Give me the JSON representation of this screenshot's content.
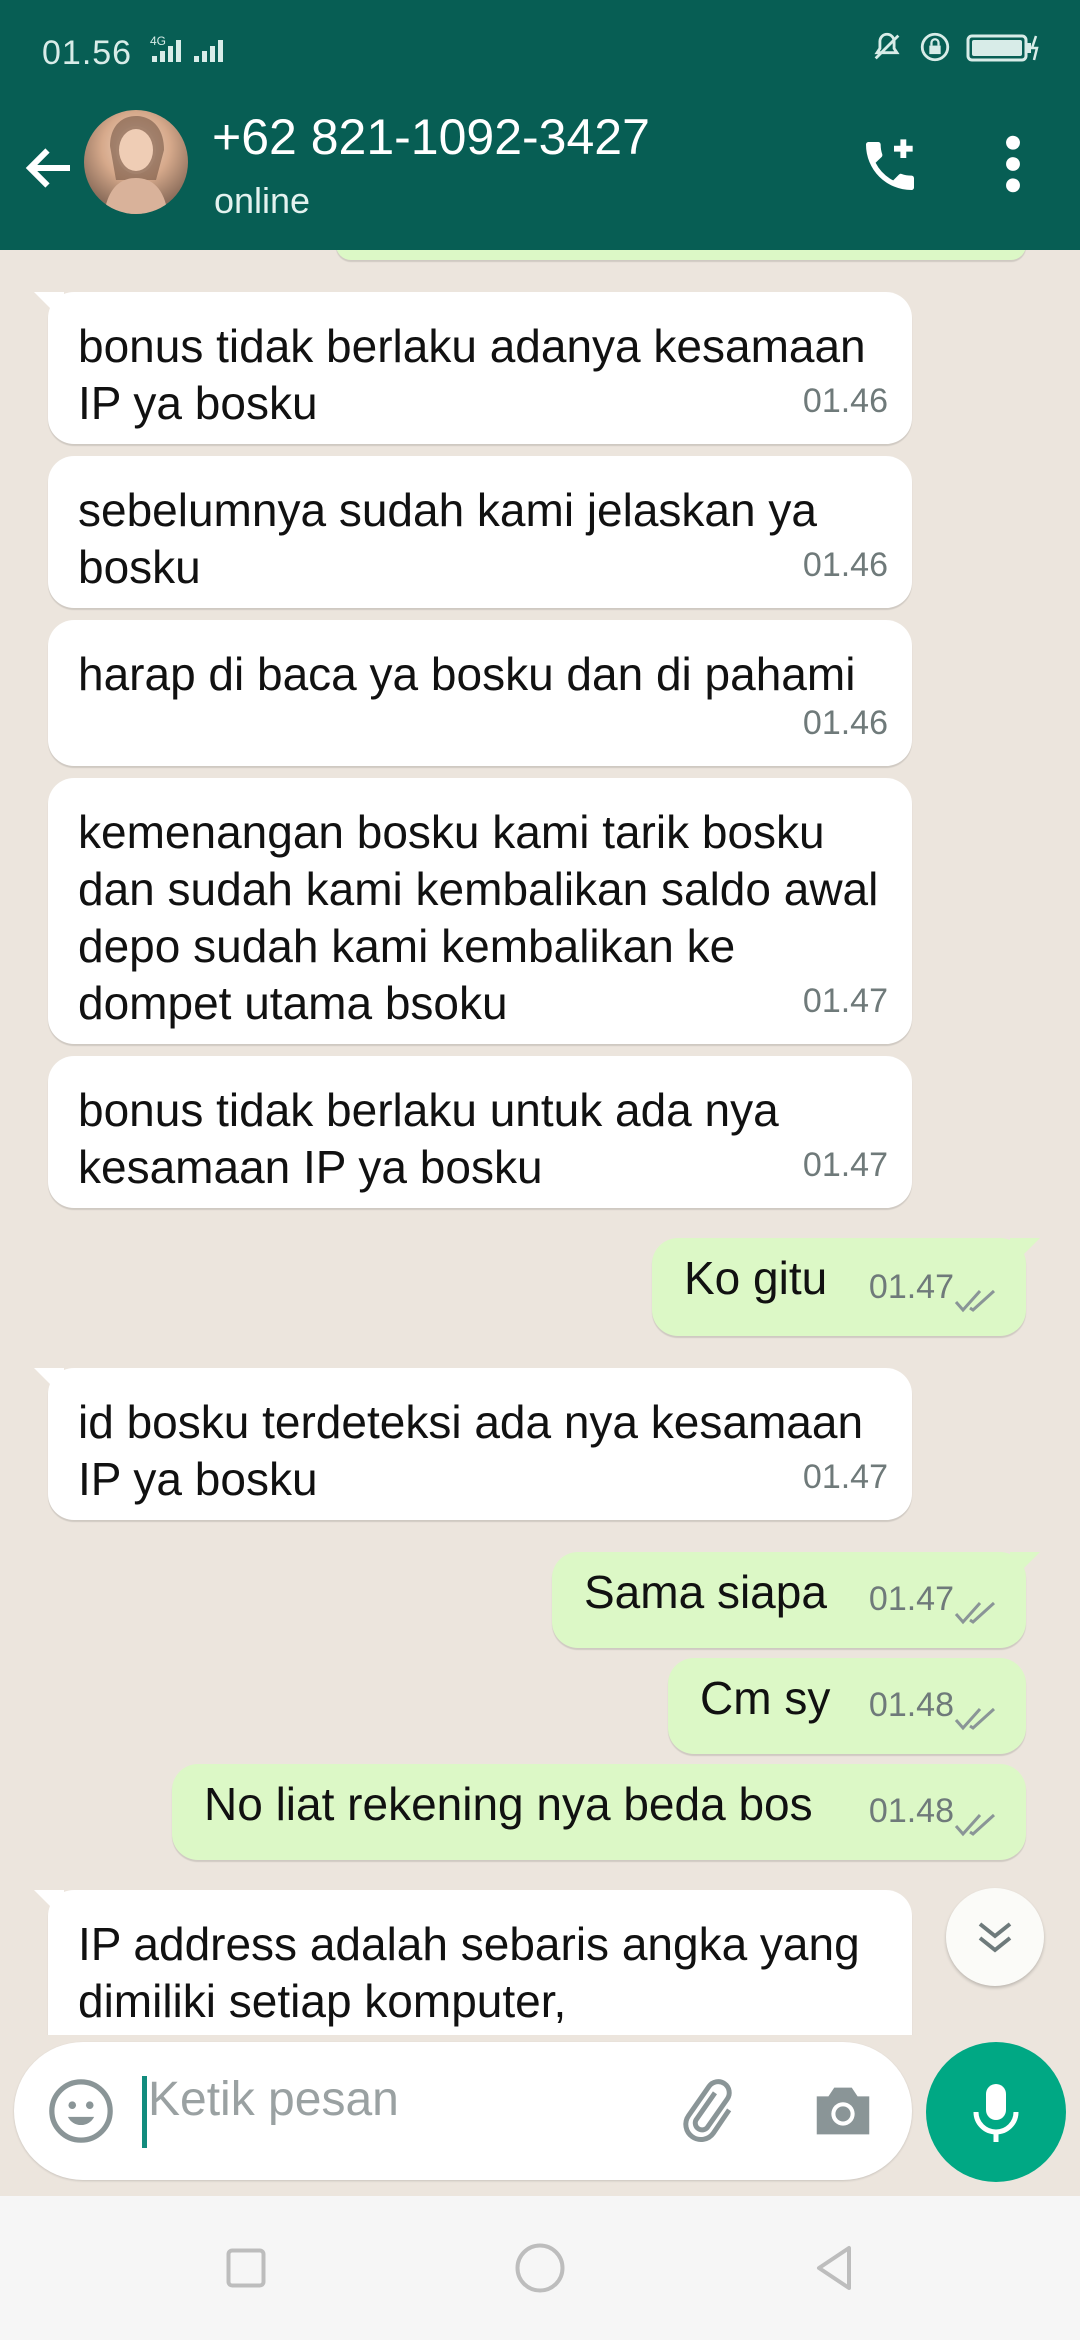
{
  "status_bar": {
    "time": "01.56",
    "network": "4G"
  },
  "header": {
    "contact_name": "+62 821-1092-3427",
    "presence": "online"
  },
  "messages": [
    {
      "dir": "in",
      "text": "bonus tidak berlaku adanya kesamaan IP ya bosku",
      "time": "01.46"
    },
    {
      "dir": "in",
      "text": "sebelumnya sudah kami jelaskan ya bosku",
      "time": "01.46"
    },
    {
      "dir": "in",
      "text": "harap di baca ya bosku dan di pahami",
      "time": "01.46"
    },
    {
      "dir": "in",
      "text": "kemenangan bosku kami tarik bosku dan sudah kami kembalikan saldo awal depo sudah kami kembalikan ke dompet utama bsoku",
      "time": "01.47"
    },
    {
      "dir": "in",
      "text": "bonus tidak berlaku untuk ada nya kesamaan IP ya bosku",
      "time": "01.47"
    },
    {
      "dir": "out",
      "text": "Ko gitu",
      "time": "01.47",
      "status": "read"
    },
    {
      "dir": "in",
      "text": "id bosku terdeteksi ada nya kesamaan IP ya bosku",
      "time": "01.47"
    },
    {
      "dir": "out",
      "text": "Sama siapa",
      "time": "01.47",
      "status": "read"
    },
    {
      "dir": "out",
      "text": "Cm sy",
      "time": "01.48",
      "status": "read"
    },
    {
      "dir": "out",
      "text": "No liat rekening nya beda bos",
      "time": "01.48",
      "status": "read"
    },
    {
      "dir": "in",
      "text": "IP address adalah sebaris angka yang dimiliki setiap komputer,",
      "time": ""
    }
  ],
  "composer": {
    "placeholder": "Ketik pesan"
  },
  "colors": {
    "header": "#075e54",
    "outgoing_bubble": "#dcf8c6",
    "incoming_bubble": "#ffffff",
    "chat_background": "#ece5dd",
    "accent": "#00a884",
    "read_ticks": "#8a9597"
  },
  "icons": [
    "back-arrow-icon",
    "add-call-icon",
    "more-vert-icon",
    "emoji-icon",
    "attach-icon",
    "camera-icon",
    "mic-icon",
    "scroll-down-icon",
    "nav-recents-icon",
    "nav-home-icon",
    "nav-back-icon"
  ]
}
